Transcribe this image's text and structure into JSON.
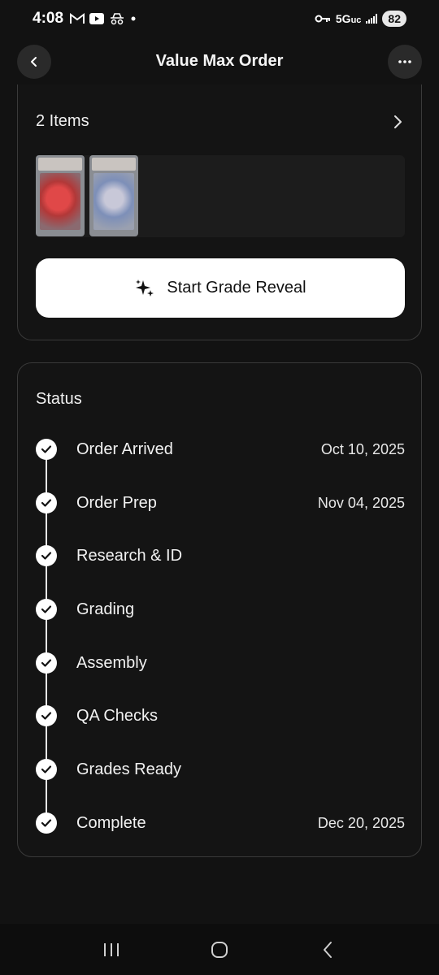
{
  "status_bar": {
    "time": "4:08",
    "network": "5G",
    "network_sub": "uc",
    "battery": "82",
    "notification_icons": [
      "gmail-icon",
      "youtube-icon",
      "incognito-icon",
      "dot-icon"
    ]
  },
  "header": {
    "title": "Value Max Order",
    "back_icon": "chevron-left-icon",
    "more_icon": "more-horizontal-icon"
  },
  "items": {
    "count_label": "2 Items",
    "chevron_icon": "chevron-right-icon",
    "reveal_button_label": "Start Grade Reveal",
    "reveal_icon": "sparkles-icon"
  },
  "status": {
    "title": "Status",
    "steps": [
      {
        "label": "Order Arrived",
        "date": "Oct 10, 2025"
      },
      {
        "label": "Order Prep",
        "date": "Nov 04, 2025"
      },
      {
        "label": "Research & ID",
        "date": ""
      },
      {
        "label": "Grading",
        "date": ""
      },
      {
        "label": "Assembly",
        "date": ""
      },
      {
        "label": "QA Checks",
        "date": ""
      },
      {
        "label": "Grades Ready",
        "date": ""
      },
      {
        "label": "Complete",
        "date": "Dec 20, 2025"
      }
    ]
  },
  "colors": {
    "background": "#121212",
    "card_border": "#3a3a3a",
    "button_bg": "#ffffff",
    "text": "#f2f2f2"
  }
}
